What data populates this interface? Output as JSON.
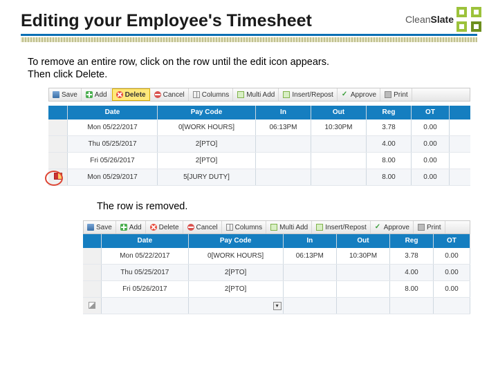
{
  "header": {
    "title": "Editing your Employee's Timesheet"
  },
  "logo": {
    "text_light": "Clean",
    "text_bold": "Slate"
  },
  "instructions": {
    "line1": "To remove an entire row, click on the row until the edit icon appears.",
    "line2": "Then click Delete."
  },
  "caption2": "The row is removed.",
  "toolbar": {
    "save": "Save",
    "add": "Add",
    "delete": "Delete",
    "cancel": "Cancel",
    "columns": "Columns",
    "multi_add": "Multi Add",
    "insert_repost": "Insert/Repost",
    "approve": "Approve",
    "print": "Print"
  },
  "toolbar_is_interactable": "true",
  "columns": {
    "date": "Date",
    "paycode": "Pay Code",
    "in": "In",
    "out": "Out",
    "reg": "Reg",
    "ot": "OT"
  },
  "grid1": {
    "rows": [
      {
        "date": "Mon 05/22/2017",
        "paycode": "0[WORK HOURS]",
        "in": "06:13PM",
        "out": "10:30PM",
        "reg": "3.78",
        "ot": "0.00"
      },
      {
        "date": "Thu 05/25/2017",
        "paycode": "2[PTO]",
        "in": "",
        "out": "",
        "reg": "4.00",
        "ot": "0.00"
      },
      {
        "date": "Fri 05/26/2017",
        "paycode": "2[PTO]",
        "in": "",
        "out": "",
        "reg": "8.00",
        "ot": "0.00"
      },
      {
        "date": "Mon 05/29/2017",
        "paycode": "5[JURY DUTY]",
        "in": "",
        "out": "",
        "reg": "8.00",
        "ot": "0.00",
        "selected": true
      }
    ]
  },
  "grid2": {
    "rows": [
      {
        "date": "Mon 05/22/2017",
        "paycode": "0[WORK HOURS]",
        "in": "06:13PM",
        "out": "10:30PM",
        "reg": "3.78",
        "ot": "0.00"
      },
      {
        "date": "Thu 05/25/2017",
        "paycode": "2[PTO]",
        "in": "",
        "out": "",
        "reg": "4.00",
        "ot": "0.00"
      },
      {
        "date": "Fri 05/26/2017",
        "paycode": "2[PTO]",
        "in": "",
        "out": "",
        "reg": "8.00",
        "ot": "0.00"
      },
      {
        "date": "",
        "paycode": "",
        "in": "",
        "out": "",
        "reg": "",
        "ot": "",
        "editing": true
      }
    ]
  }
}
